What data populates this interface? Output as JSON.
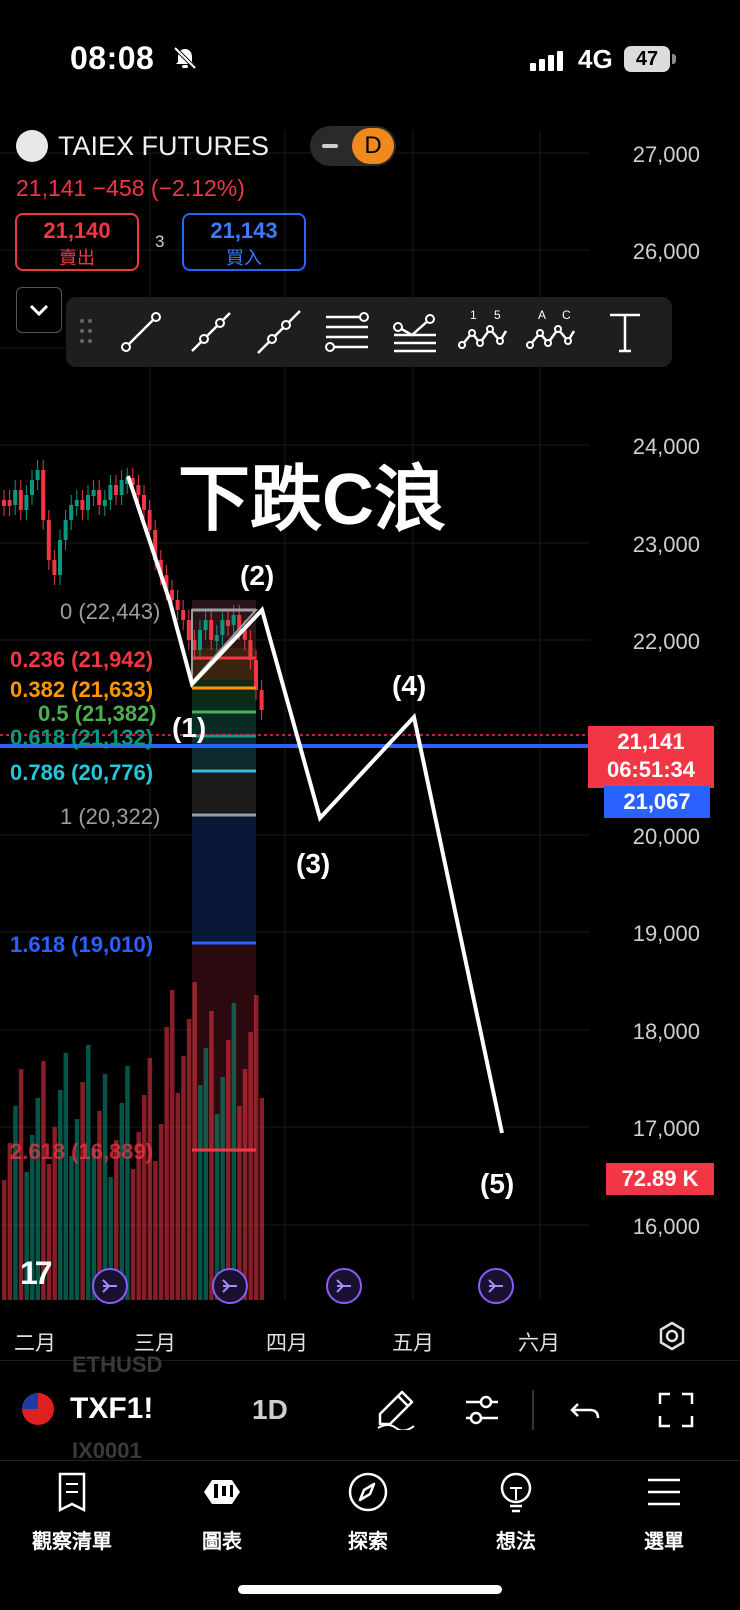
{
  "status_bar": {
    "time": "08:08",
    "network": "4G",
    "battery": "47"
  },
  "header": {
    "symbol": "TAIEX FUTURES",
    "interval_badge": "D",
    "price_change": "21,141 −458 (−2.12%)",
    "sell_price": "21,140",
    "sell_label": "賣出",
    "spread": "3",
    "buy_price": "21,143",
    "buy_label": "買入"
  },
  "chart": {
    "annotation_title": "下跌C浪",
    "y_ticks": [
      "27,000",
      "26,000",
      "24,000",
      "23,000",
      "22,000",
      "20,000",
      "19,000",
      "18,000",
      "17,000",
      "16,000"
    ],
    "x_ticks": [
      "二月",
      "三月",
      "四月",
      "五月",
      "六月"
    ],
    "fib_levels": [
      {
        "label": "0 (22,443)",
        "color": "#9e9e9e"
      },
      {
        "label": "0.236 (21,942)",
        "color": "#f23645"
      },
      {
        "label": "0.382 (21,633)",
        "color": "#ff9800"
      },
      {
        "label": "0.5 (21,382)",
        "color": "#4caf50"
      },
      {
        "label": "0.618 (21,132)",
        "color": "#089981"
      },
      {
        "label": "0.786 (20,776)",
        "color": "#26c6da"
      },
      {
        "label": "1 (20,322)",
        "color": "#9e9e9e"
      },
      {
        "label": "1.618 (19,010)",
        "color": "#2962ff"
      },
      {
        "label": "2.618 (16,889)",
        "color": "#f23645"
      }
    ],
    "wave_labels": [
      "(1)",
      "(2)",
      "(3)",
      "(4)",
      "(5)"
    ],
    "last_price_tag": "21,141",
    "countdown_tag": "06:51:34",
    "line_price_tag": "21,067",
    "volume_tag": "72.89 K"
  },
  "bottom_toolbar": {
    "symbol": "TXF1!",
    "interval": "1D",
    "ghost_above": "ETHUSD",
    "ghost_below": "IX0001"
  },
  "nav": {
    "items": [
      {
        "label": "觀察清單",
        "icon": "watchlist-icon"
      },
      {
        "label": "圖表",
        "icon": "chart-icon"
      },
      {
        "label": "探索",
        "icon": "explore-icon"
      },
      {
        "label": "想法",
        "icon": "ideas-icon"
      },
      {
        "label": "選單",
        "icon": "menu-icon"
      }
    ]
  },
  "colors": {
    "up": "#089981",
    "down": "#f23645",
    "accent": "#2962ff",
    "badge": "#f08a1c"
  }
}
